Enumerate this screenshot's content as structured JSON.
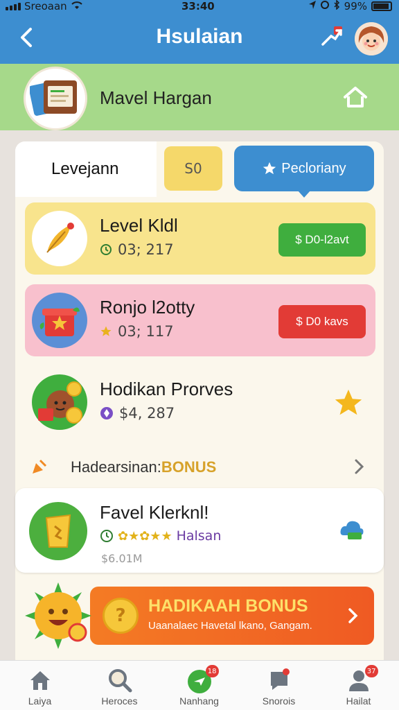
{
  "status_bar": {
    "carrier": "Sreoaan",
    "time": "33:40",
    "battery": "99%"
  },
  "header": {
    "title": "Hsulaian"
  },
  "profile": {
    "name": "Mavel Hargan"
  },
  "tabs": {
    "level_label": "Levejann",
    "score": "S0",
    "popular_label": "Pecloriany"
  },
  "items": [
    {
      "title": "Level Kldl",
      "sub": "03; 217",
      "action": "$ D0-l2avt"
    },
    {
      "title": "Ronjo l2otty",
      "sub": "03; 117",
      "action": "$ D0 kavs"
    },
    {
      "title": "Hodikan Prorves",
      "sub": "$4, 287"
    }
  ],
  "bonus": {
    "prefix": "Hadearsinan:",
    "highlight": "BONUS"
  },
  "featured": {
    "title": "Favel Klerknl!",
    "sub": "Halsan",
    "amount": "$6.01M"
  },
  "promo": {
    "title": "HADIKAAH BONUS",
    "subtitle": "Uaanalaec Havetal lkano, Gangam."
  },
  "nav": [
    {
      "label": "Laiya",
      "badge": ""
    },
    {
      "label": "Heroces",
      "badge": ""
    },
    {
      "label": "Nanhang",
      "badge": "18"
    },
    {
      "label": "Snorois",
      "badge": ""
    },
    {
      "label": "Hailat",
      "badge": "37"
    }
  ],
  "colors": {
    "header_blue": "#3d8ed0",
    "profile_green": "#a6d98a",
    "item_yellow": "#f8e48d",
    "item_pink": "#f8c0cd",
    "action_green": "#3fae3e",
    "action_red": "#e23b36",
    "promo_orange": "#f47b24"
  }
}
